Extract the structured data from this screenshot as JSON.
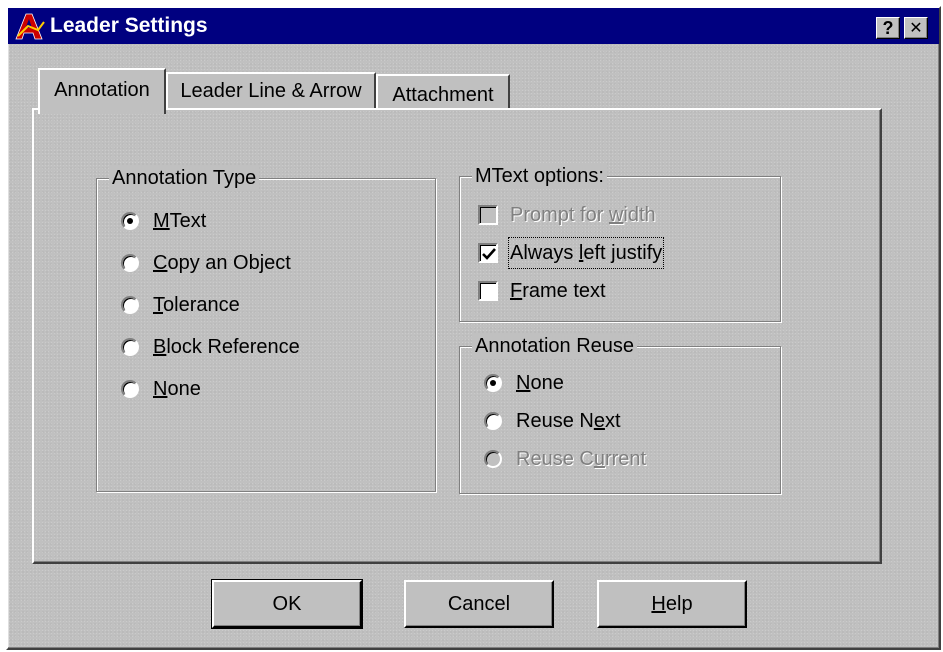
{
  "window": {
    "title": "Leader Settings",
    "help_glyph": "?",
    "close_glyph": "✕"
  },
  "tabs": [
    {
      "label": "Annotation",
      "active": true
    },
    {
      "label": "Leader Line & Arrow",
      "active": false
    },
    {
      "label": "Attachment",
      "active": false
    }
  ],
  "annotation_type": {
    "title": "Annotation Type",
    "options": [
      {
        "pre": "",
        "ul": "M",
        "post": "Text",
        "selected": true
      },
      {
        "pre": "",
        "ul": "C",
        "post": "opy an Object",
        "selected": false
      },
      {
        "pre": "",
        "ul": "T",
        "post": "olerance",
        "selected": false
      },
      {
        "pre": "",
        "ul": "B",
        "post": "lock Reference",
        "selected": false
      },
      {
        "pre": "",
        "ul": "N",
        "post": "one",
        "selected": false
      }
    ]
  },
  "mtext_options": {
    "title": "MText options:",
    "items": [
      {
        "pre": "Prompt for ",
        "ul": "w",
        "post": "idth",
        "checked": false,
        "enabled": false
      },
      {
        "pre": "Always ",
        "ul": "l",
        "post": "eft justify",
        "checked": true,
        "enabled": true
      },
      {
        "pre": "",
        "ul": "F",
        "post": "rame text",
        "checked": false,
        "enabled": true
      }
    ]
  },
  "annotation_reuse": {
    "title": "Annotation Reuse",
    "options": [
      {
        "pre": "",
        "ul": "N",
        "post": "one",
        "selected": true,
        "enabled": true
      },
      {
        "pre": "Reuse N",
        "ul": "e",
        "post": "xt",
        "selected": false,
        "enabled": true
      },
      {
        "pre": "Reuse C",
        "ul": "u",
        "post": "rrent",
        "selected": false,
        "enabled": false
      }
    ]
  },
  "buttons": {
    "ok": "OK",
    "cancel": "Cancel",
    "help_ul": "H",
    "help_post": "elp"
  },
  "colors": {
    "titlebar": "#000080",
    "face": "#c0c0c0",
    "disabled_text": "#808080"
  }
}
